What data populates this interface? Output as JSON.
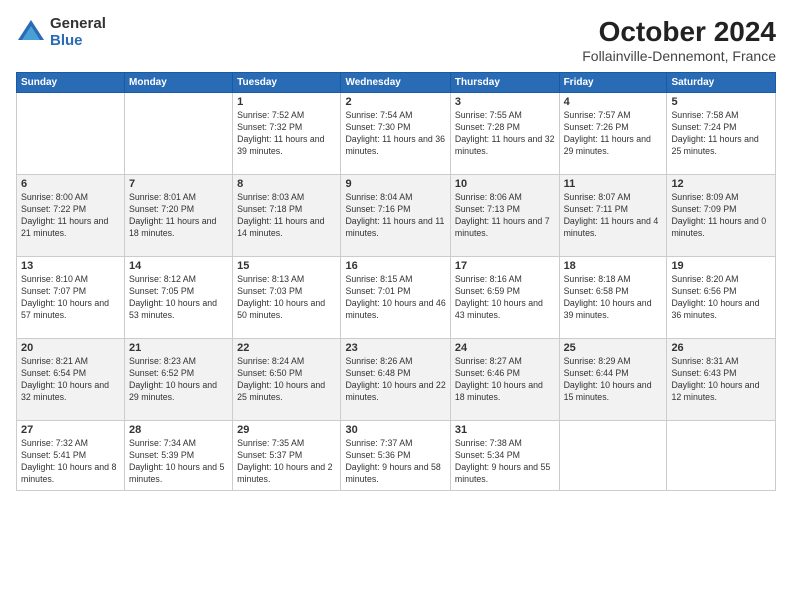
{
  "logo": {
    "general": "General",
    "blue": "Blue"
  },
  "title": "October 2024",
  "location": "Follainville-Dennemont, France",
  "headers": [
    "Sunday",
    "Monday",
    "Tuesday",
    "Wednesday",
    "Thursday",
    "Friday",
    "Saturday"
  ],
  "weeks": [
    [
      {
        "day": "",
        "info": ""
      },
      {
        "day": "",
        "info": ""
      },
      {
        "day": "1",
        "info": "Sunrise: 7:52 AM\nSunset: 7:32 PM\nDaylight: 11 hours and 39 minutes."
      },
      {
        "day": "2",
        "info": "Sunrise: 7:54 AM\nSunset: 7:30 PM\nDaylight: 11 hours and 36 minutes."
      },
      {
        "day": "3",
        "info": "Sunrise: 7:55 AM\nSunset: 7:28 PM\nDaylight: 11 hours and 32 minutes."
      },
      {
        "day": "4",
        "info": "Sunrise: 7:57 AM\nSunset: 7:26 PM\nDaylight: 11 hours and 29 minutes."
      },
      {
        "day": "5",
        "info": "Sunrise: 7:58 AM\nSunset: 7:24 PM\nDaylight: 11 hours and 25 minutes."
      }
    ],
    [
      {
        "day": "6",
        "info": "Sunrise: 8:00 AM\nSunset: 7:22 PM\nDaylight: 11 hours and 21 minutes."
      },
      {
        "day": "7",
        "info": "Sunrise: 8:01 AM\nSunset: 7:20 PM\nDaylight: 11 hours and 18 minutes."
      },
      {
        "day": "8",
        "info": "Sunrise: 8:03 AM\nSunset: 7:18 PM\nDaylight: 11 hours and 14 minutes."
      },
      {
        "day": "9",
        "info": "Sunrise: 8:04 AM\nSunset: 7:16 PM\nDaylight: 11 hours and 11 minutes."
      },
      {
        "day": "10",
        "info": "Sunrise: 8:06 AM\nSunset: 7:13 PM\nDaylight: 11 hours and 7 minutes."
      },
      {
        "day": "11",
        "info": "Sunrise: 8:07 AM\nSunset: 7:11 PM\nDaylight: 11 hours and 4 minutes."
      },
      {
        "day": "12",
        "info": "Sunrise: 8:09 AM\nSunset: 7:09 PM\nDaylight: 11 hours and 0 minutes."
      }
    ],
    [
      {
        "day": "13",
        "info": "Sunrise: 8:10 AM\nSunset: 7:07 PM\nDaylight: 10 hours and 57 minutes."
      },
      {
        "day": "14",
        "info": "Sunrise: 8:12 AM\nSunset: 7:05 PM\nDaylight: 10 hours and 53 minutes."
      },
      {
        "day": "15",
        "info": "Sunrise: 8:13 AM\nSunset: 7:03 PM\nDaylight: 10 hours and 50 minutes."
      },
      {
        "day": "16",
        "info": "Sunrise: 8:15 AM\nSunset: 7:01 PM\nDaylight: 10 hours and 46 minutes."
      },
      {
        "day": "17",
        "info": "Sunrise: 8:16 AM\nSunset: 6:59 PM\nDaylight: 10 hours and 43 minutes."
      },
      {
        "day": "18",
        "info": "Sunrise: 8:18 AM\nSunset: 6:58 PM\nDaylight: 10 hours and 39 minutes."
      },
      {
        "day": "19",
        "info": "Sunrise: 8:20 AM\nSunset: 6:56 PM\nDaylight: 10 hours and 36 minutes."
      }
    ],
    [
      {
        "day": "20",
        "info": "Sunrise: 8:21 AM\nSunset: 6:54 PM\nDaylight: 10 hours and 32 minutes."
      },
      {
        "day": "21",
        "info": "Sunrise: 8:23 AM\nSunset: 6:52 PM\nDaylight: 10 hours and 29 minutes."
      },
      {
        "day": "22",
        "info": "Sunrise: 8:24 AM\nSunset: 6:50 PM\nDaylight: 10 hours and 25 minutes."
      },
      {
        "day": "23",
        "info": "Sunrise: 8:26 AM\nSunset: 6:48 PM\nDaylight: 10 hours and 22 minutes."
      },
      {
        "day": "24",
        "info": "Sunrise: 8:27 AM\nSunset: 6:46 PM\nDaylight: 10 hours and 18 minutes."
      },
      {
        "day": "25",
        "info": "Sunrise: 8:29 AM\nSunset: 6:44 PM\nDaylight: 10 hours and 15 minutes."
      },
      {
        "day": "26",
        "info": "Sunrise: 8:31 AM\nSunset: 6:43 PM\nDaylight: 10 hours and 12 minutes."
      }
    ],
    [
      {
        "day": "27",
        "info": "Sunrise: 7:32 AM\nSunset: 5:41 PM\nDaylight: 10 hours and 8 minutes."
      },
      {
        "day": "28",
        "info": "Sunrise: 7:34 AM\nSunset: 5:39 PM\nDaylight: 10 hours and 5 minutes."
      },
      {
        "day": "29",
        "info": "Sunrise: 7:35 AM\nSunset: 5:37 PM\nDaylight: 10 hours and 2 minutes."
      },
      {
        "day": "30",
        "info": "Sunrise: 7:37 AM\nSunset: 5:36 PM\nDaylight: 9 hours and 58 minutes."
      },
      {
        "day": "31",
        "info": "Sunrise: 7:38 AM\nSunset: 5:34 PM\nDaylight: 9 hours and 55 minutes."
      },
      {
        "day": "",
        "info": ""
      },
      {
        "day": "",
        "info": ""
      }
    ]
  ]
}
